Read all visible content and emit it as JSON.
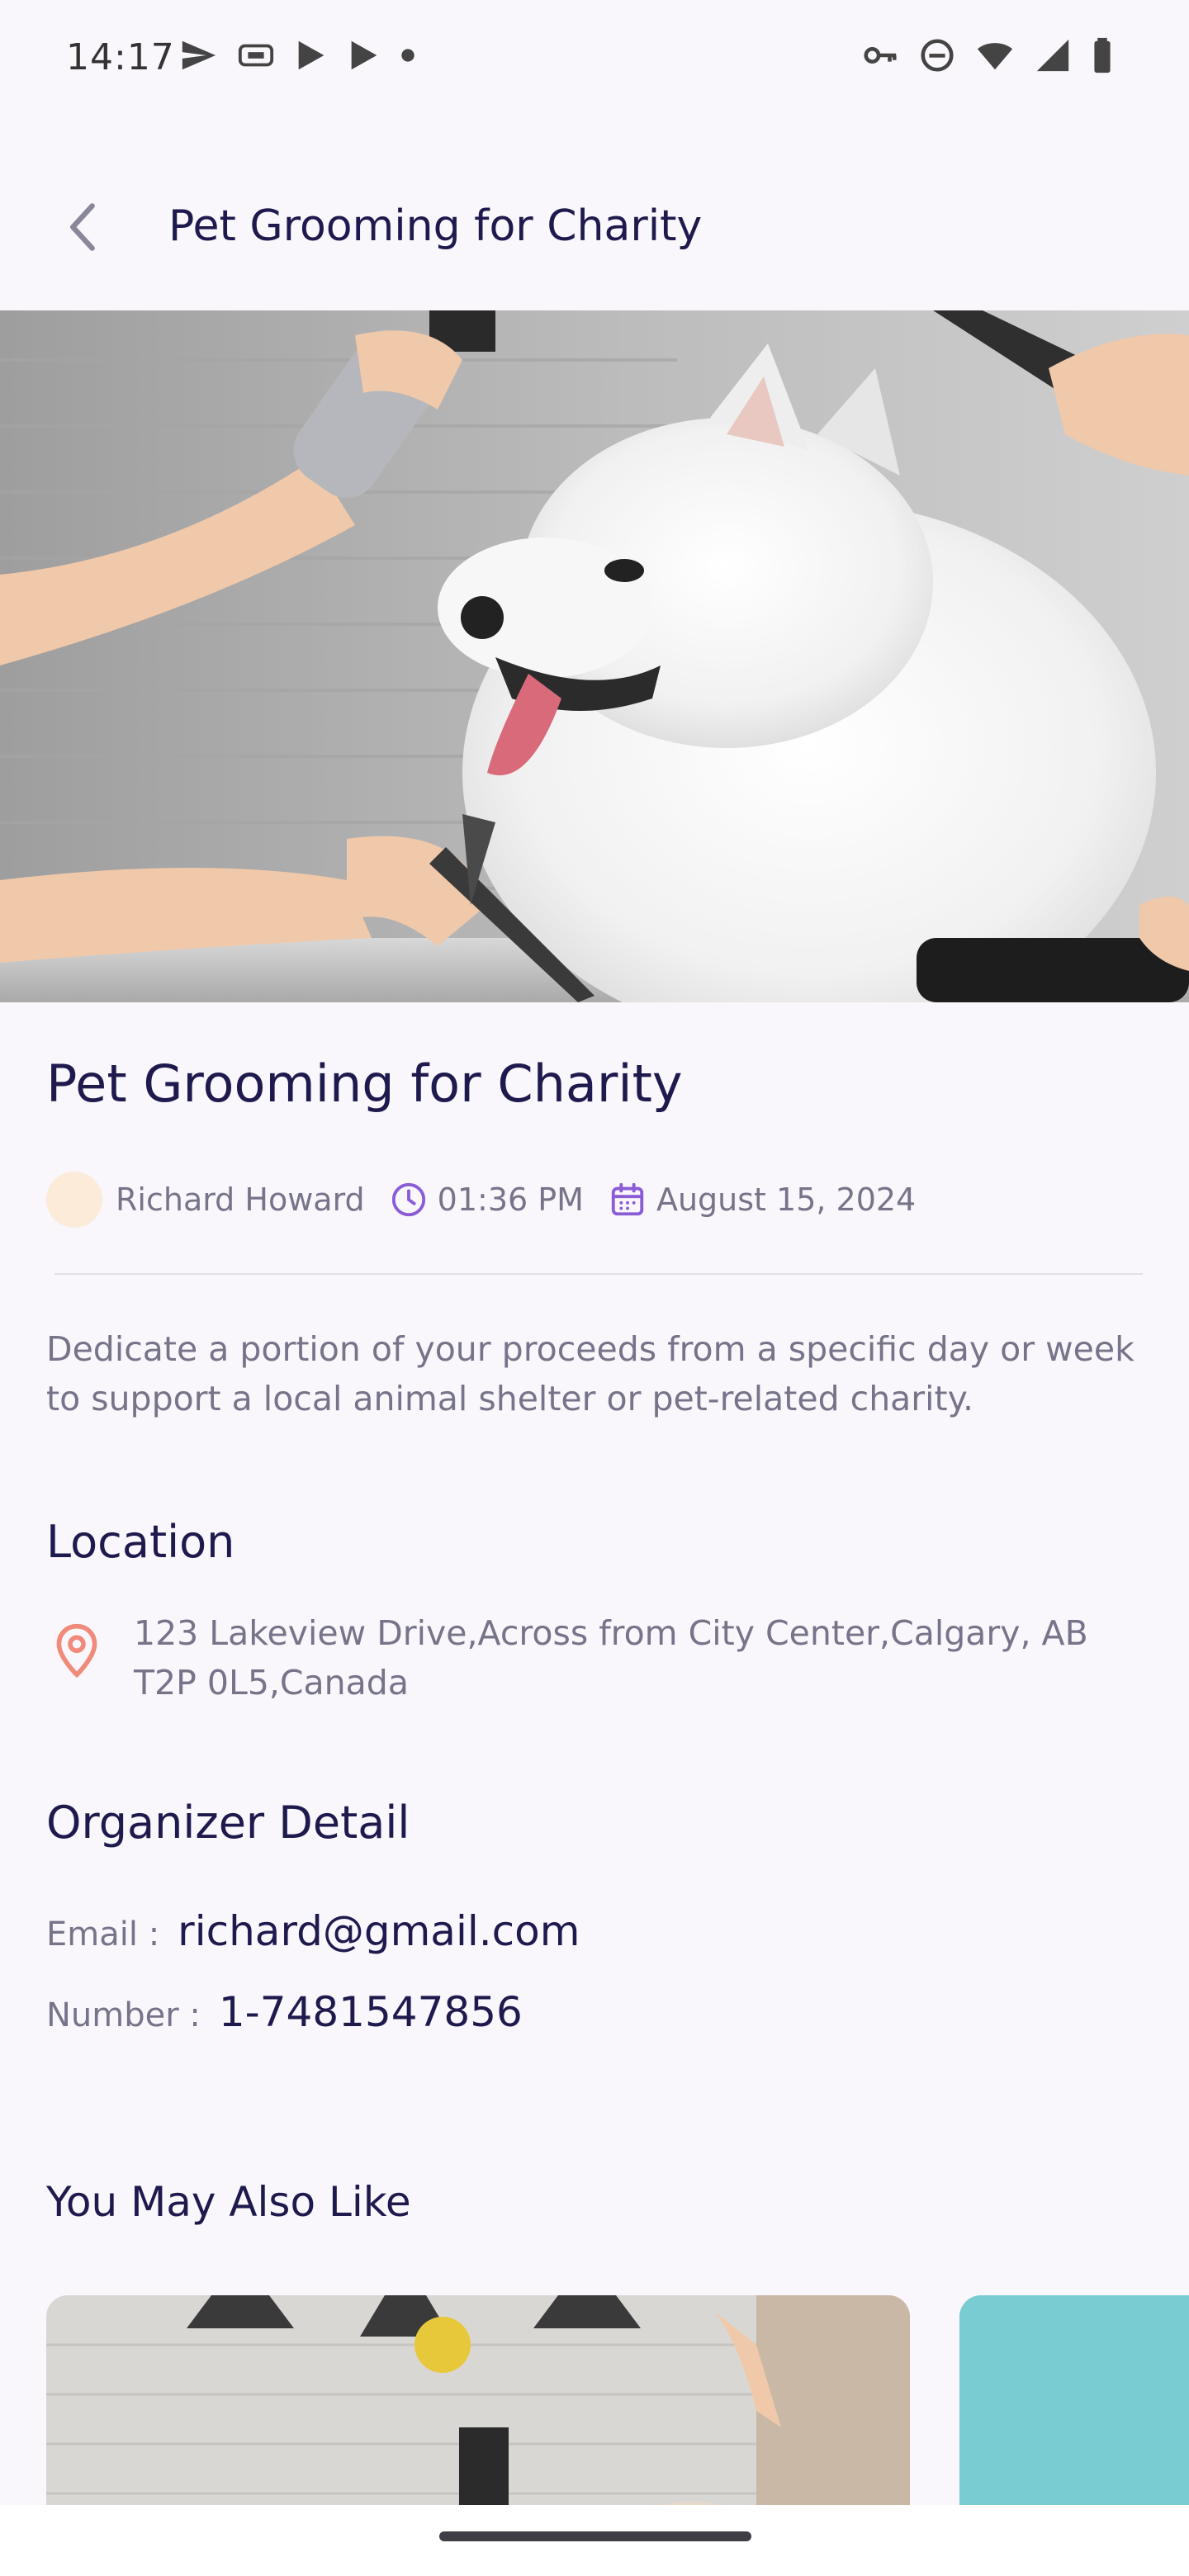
{
  "status_bar": {
    "time": "14:17"
  },
  "app_bar": {
    "title": "Pet Grooming for Charity"
  },
  "event": {
    "title": "Pet Grooming for Charity",
    "organizer_name": "Richard Howard",
    "time": "01:36 PM",
    "date": "August 15, 2024",
    "description": "Dedicate a portion of your proceeds from a specific day or week to support a local animal shelter or pet-related charity."
  },
  "location": {
    "heading": "Location",
    "address": "123 Lakeview Drive,Across from City Center,Calgary, AB T2P 0L5,Canada"
  },
  "organizer": {
    "heading": "Organizer Detail",
    "email_label": "Email :",
    "email": "richard@gmail.com",
    "number_label": "Number :",
    "number": "1-7481547856"
  },
  "related": {
    "heading": "You May Also Like"
  },
  "icons": {
    "back": "chevron-left-icon",
    "clock": "clock-icon",
    "calendar": "calendar-icon",
    "location": "location-pin-icon"
  },
  "colors": {
    "background": "#f9f6fc",
    "title": "#1f1a4d",
    "secondary_text": "#77748a",
    "accent_purple": "#8a5cd6",
    "location_icon": "#f08a7a",
    "avatar_bg": "#fcebd9"
  }
}
